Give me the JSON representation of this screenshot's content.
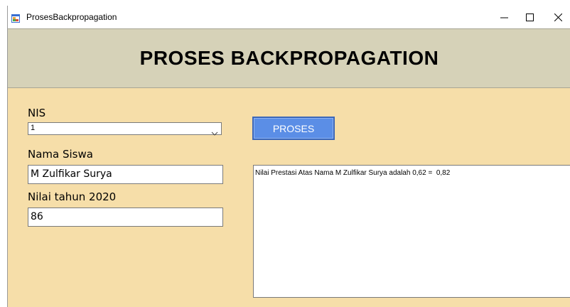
{
  "window": {
    "title": "ProsesBackpropagation",
    "minimize_glyph": "minimize-icon",
    "maximize_glyph": "maximize-icon",
    "close_glyph": "close-icon",
    "app_icon": "app-form-icon"
  },
  "header": {
    "title": "PROSES BACKPROPAGATION"
  },
  "form": {
    "nis_label": "NIS",
    "nis_value": "1",
    "nama_label": "Nama Siswa",
    "nama_value": "M Zulfikar Surya",
    "nilai_label": "Nilai tahun 2020",
    "nilai_value": "86",
    "proses_button": "PROSES",
    "output_text": "Nilai Prestasi Atas Nama M Zulfikar Surya adalah 0,62 =  0,82"
  },
  "colors": {
    "header_band": "#d6d2b8",
    "client_background": "#f6dea9",
    "button_fill": "#5b8ee6",
    "button_text": "#ffffff"
  }
}
